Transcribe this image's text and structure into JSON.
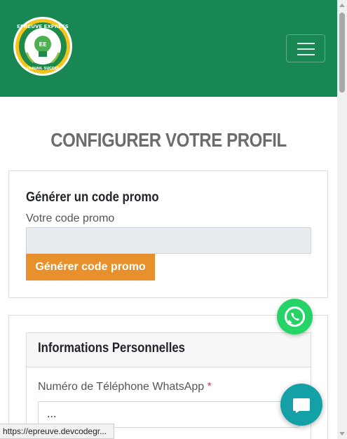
{
  "navbar": {
    "brand_color": "#198754",
    "logo": {
      "top_text": "EPREUVE EXPRESS",
      "center_text": "EE",
      "bottom_text": "TRAVAIL SUCCES"
    },
    "toggler_icon": "hamburger-icon"
  },
  "page": {
    "title": "CONFIGURER VOTRE PROFIL"
  },
  "promo_card": {
    "title": "Générer un code promo",
    "label": "Votre code promo",
    "input_value": "",
    "button_label": "Générer code promo",
    "button_color": "#e8912c"
  },
  "personal_info": {
    "title": "Informations Personnelles",
    "phone_label": "Numéro de Téléphone WhatsApp",
    "required_mark": "*",
    "phone_value": "..."
  },
  "floating": {
    "whatsapp_icon": "whatsapp-icon",
    "chat_icon": "chat-bubble-icon"
  },
  "status_bar": {
    "url": "https://epreuve.devcodegr..."
  }
}
